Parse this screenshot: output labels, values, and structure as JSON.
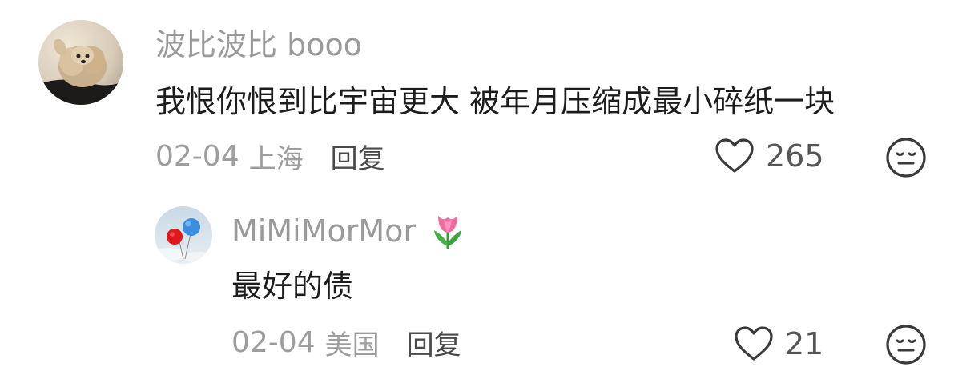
{
  "comment": {
    "username": "波比波比 booo",
    "text": "我恨你恨到比宇宙更大 被年月压缩成最小碎纸一块",
    "date": "02-04",
    "location": "上海",
    "reply_label": "回复",
    "like_count": "265",
    "avatar_icon": "puppy-avatar",
    "like_icon": "heart-outline-icon",
    "dislike_icon": "expressionless-face-icon"
  },
  "reply": {
    "username": "MiMiMorMor",
    "username_badge_icon": "tulip-emoji",
    "text": "最好的债",
    "date": "02-04",
    "location": "美国",
    "reply_label": "回复",
    "like_count": "21",
    "avatar_icon": "balloons-avatar",
    "like_icon": "heart-outline-icon",
    "dislike_icon": "expressionless-face-icon"
  },
  "colors": {
    "username": "#9a9a9a",
    "body_text": "#1c1c1c",
    "meta_text": "#9d9d9d",
    "reply_action": "#4a4a4a",
    "icon_stroke": "#3a3a3a"
  }
}
